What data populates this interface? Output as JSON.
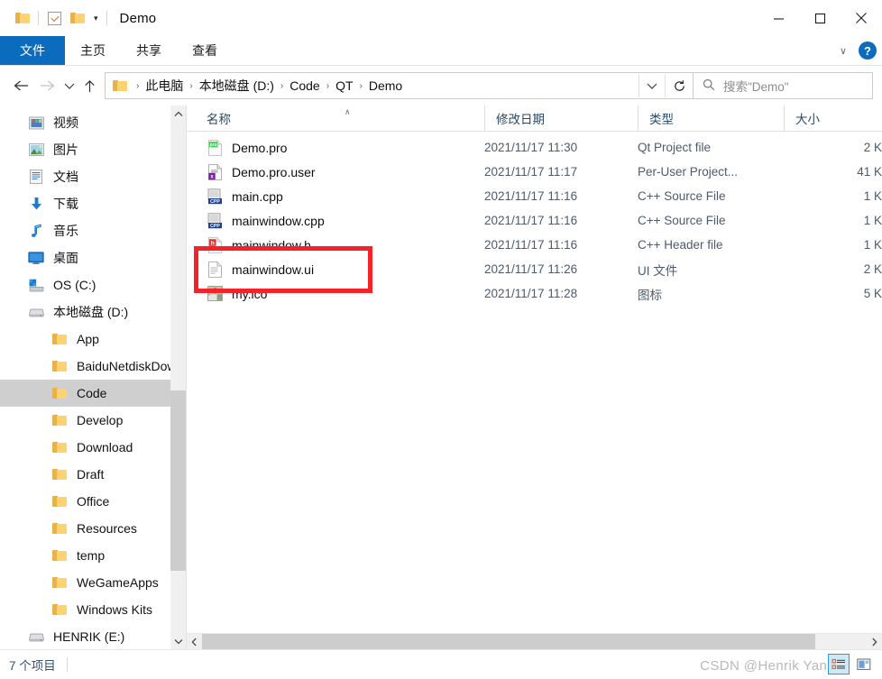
{
  "titlebar": {
    "window_title": "Demo",
    "quick_access": [
      {
        "name": "folder-icon",
        "label": ""
      },
      {
        "name": "properties-checkbox-icon",
        "label": ""
      },
      {
        "name": "new-folder-icon",
        "label": ""
      }
    ],
    "customize_caret": "▾",
    "minimize": "—",
    "maximize": "□",
    "close": "✕"
  },
  "ribbon": {
    "tabs": [
      {
        "label": "文件",
        "active": true
      },
      {
        "label": "主页",
        "active": false
      },
      {
        "label": "共享",
        "active": false
      },
      {
        "label": "查看",
        "active": false
      }
    ],
    "expand_caret": "∨",
    "help_label": "?"
  },
  "address": {
    "back": "←",
    "forward": "→",
    "recent_caret": "∨",
    "up": "↑",
    "breadcrumbs": [
      "此电脑",
      "本地磁盘 (D:)",
      "Code",
      "QT",
      "Demo"
    ],
    "separator": "›",
    "dropdown_caret": "∨",
    "refresh": "↻",
    "search_placeholder": "搜索\"Demo\""
  },
  "sidebar": {
    "items": [
      {
        "label": "视频",
        "icon": "video-icon",
        "level": 1,
        "selected": false
      },
      {
        "label": "图片",
        "icon": "pictures-icon",
        "level": 1,
        "selected": false
      },
      {
        "label": "文档",
        "icon": "documents-icon",
        "level": 1,
        "selected": false
      },
      {
        "label": "下载",
        "icon": "downloads-icon",
        "level": 1,
        "selected": false
      },
      {
        "label": "音乐",
        "icon": "music-icon",
        "level": 1,
        "selected": false
      },
      {
        "label": "桌面",
        "icon": "desktop-icon",
        "level": 1,
        "selected": false
      },
      {
        "label": "OS (C:)",
        "icon": "windows-drive-icon",
        "level": 1,
        "selected": false
      },
      {
        "label": "本地磁盘 (D:)",
        "icon": "drive-icon",
        "level": 1,
        "selected": false
      },
      {
        "label": "App",
        "icon": "folder-icon",
        "level": 2,
        "selected": false
      },
      {
        "label": "BaiduNetdiskDow",
        "icon": "folder-icon",
        "level": 2,
        "selected": false
      },
      {
        "label": "Code",
        "icon": "folder-icon",
        "level": 2,
        "selected": true
      },
      {
        "label": "Develop",
        "icon": "folder-icon",
        "level": 2,
        "selected": false
      },
      {
        "label": "Download",
        "icon": "folder-icon",
        "level": 2,
        "selected": false
      },
      {
        "label": "Draft",
        "icon": "folder-icon",
        "level": 2,
        "selected": false
      },
      {
        "label": "Office",
        "icon": "folder-icon",
        "level": 2,
        "selected": false
      },
      {
        "label": "Resources",
        "icon": "folder-icon",
        "level": 2,
        "selected": false
      },
      {
        "label": "temp",
        "icon": "folder-icon",
        "level": 2,
        "selected": false
      },
      {
        "label": "WeGameApps",
        "icon": "folder-icon",
        "level": 2,
        "selected": false
      },
      {
        "label": "Windows Kits",
        "icon": "folder-icon",
        "level": 2,
        "selected": false
      },
      {
        "label": "HENRIK (E:)",
        "icon": "drive-icon",
        "level": 1,
        "selected": false
      }
    ],
    "scroll_up": "∧",
    "scroll_down": "∨"
  },
  "filelist": {
    "columns": [
      {
        "label": "名称",
        "sorted": true,
        "sort_mark": "∧"
      },
      {
        "label": "修改日期",
        "sorted": false,
        "sort_mark": ""
      },
      {
        "label": "类型",
        "sorted": false,
        "sort_mark": ""
      },
      {
        "label": "大小",
        "sorted": false,
        "sort_mark": ""
      }
    ],
    "rows": [
      {
        "name": "Demo.pro",
        "icon": "pro-file-icon",
        "date": "2021/11/17 11:30",
        "type": "Qt Project file",
        "size": "2 K"
      },
      {
        "name": "Demo.pro.user",
        "icon": "xml-user-file-icon",
        "date": "2021/11/17 11:17",
        "type": "Per-User Project...",
        "size": "41 K"
      },
      {
        "name": "main.cpp",
        "icon": "cpp-source-icon",
        "date": "2021/11/17 11:16",
        "type": "C++ Source File",
        "size": "1 K"
      },
      {
        "name": "mainwindow.cpp",
        "icon": "cpp-source-icon",
        "date": "2021/11/17 11:16",
        "type": "C++ Source File",
        "size": "1 K"
      },
      {
        "name": "mainwindow.h",
        "icon": "h-header-icon",
        "date": "2021/11/17 11:16",
        "type": "C++ Header file",
        "size": "1 K"
      },
      {
        "name": "mainwindow.ui",
        "icon": "ui-file-icon",
        "date": "2021/11/17 11:26",
        "type": "UI 文件",
        "size": "2 K"
      },
      {
        "name": "my.ico",
        "icon": "ico-thumbnail-icon",
        "date": "2021/11/17 11:28",
        "type": "图标",
        "size": "5 K"
      }
    ],
    "hscroll_left": "‹",
    "hscroll_right": "›"
  },
  "annotation": {
    "highlight_color": "#f4232a",
    "target_row": "my.ico"
  },
  "statusbar": {
    "item_count": "7 个项目",
    "watermark": "CSDN @Henrik Yang",
    "view_details_icon": "details-view-icon",
    "view_large_icon": "large-icons-view-icon"
  }
}
